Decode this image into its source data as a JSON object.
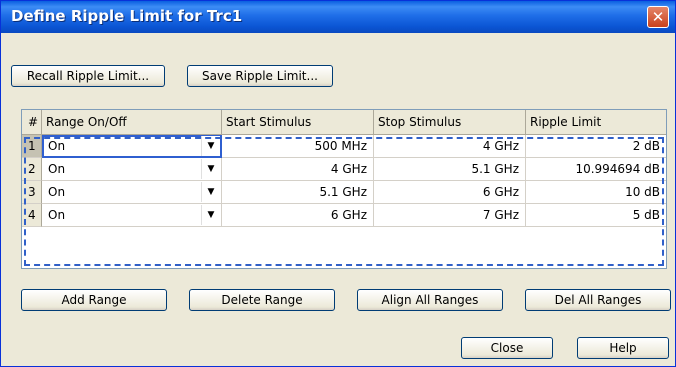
{
  "dialog": {
    "title": "Define Ripple Limit for Trc1",
    "close_icon": "close-icon"
  },
  "toolbar": {
    "recall_label": "Recall Ripple Limit...",
    "save_label": "Save Ripple Limit..."
  },
  "table": {
    "headers": [
      "#",
      "Range On/Off",
      "Start Stimulus",
      "Stop Stimulus",
      "Ripple Limit"
    ],
    "rows": [
      {
        "index": "1",
        "range": "On",
        "start": "500 MHz",
        "stop": "4 GHz",
        "limit": "2 dB"
      },
      {
        "index": "2",
        "range": "On",
        "start": "4 GHz",
        "stop": "5.1 GHz",
        "limit": "10.994694 dB"
      },
      {
        "index": "3",
        "range": "On",
        "start": "5.1 GHz",
        "stop": "6 GHz",
        "limit": "10 dB"
      },
      {
        "index": "4",
        "range": "On",
        "start": "6 GHz",
        "stop": "7 GHz",
        "limit": "5 dB"
      }
    ],
    "dropdown_icon": "chevron-down-icon"
  },
  "actions": {
    "add_label": "Add Range",
    "delete_label": "Delete Range",
    "align_label": "Align All Ranges",
    "delall_label": "Del All Ranges"
  },
  "footer": {
    "close_label": "Close",
    "help_label": "Help"
  },
  "colors": {
    "title_bar": "#0a5fe0",
    "dialog_bg": "#ece9d8",
    "selection_border": "#3060c8"
  }
}
